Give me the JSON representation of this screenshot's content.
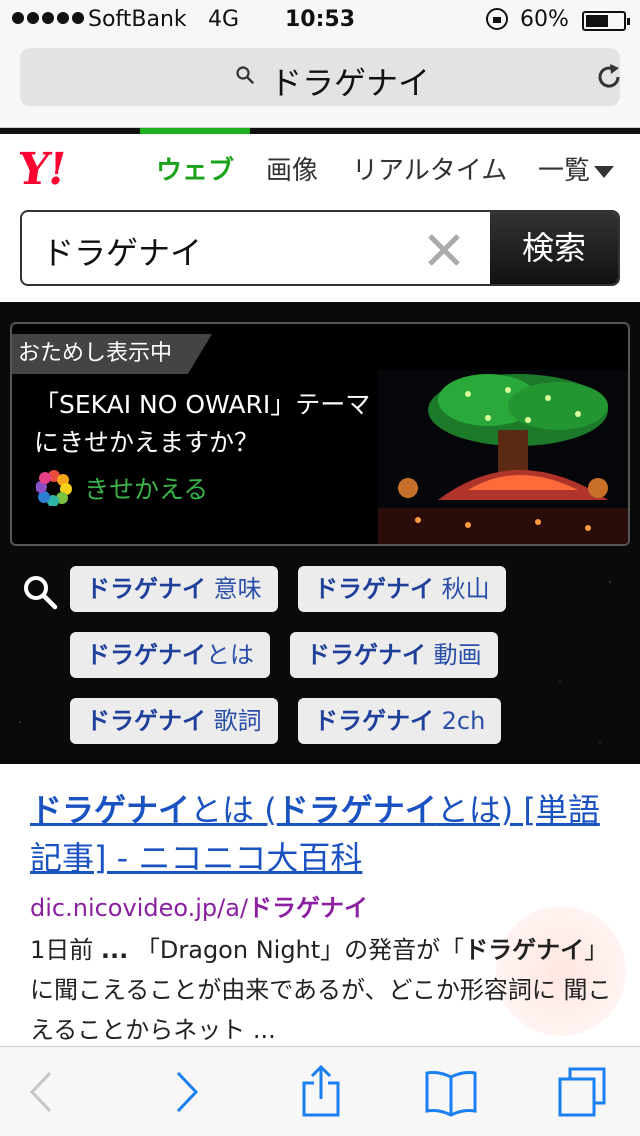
{
  "status": {
    "carrier": "SoftBank",
    "network": "4G",
    "time": "10:53",
    "battery": "60%",
    "battery_level": 0.6
  },
  "address_bar": {
    "url": "ドラゲナイ"
  },
  "header": {
    "logo": "Y!",
    "tabs": [
      "ウェブ",
      "画像",
      "リアルタイム",
      "一覧"
    ],
    "active_tab": "ウェブ",
    "colors": {
      "logo": "#ff0033",
      "active": "#1aa31a"
    }
  },
  "search": {
    "value": "ドラゲナイ",
    "button": "検索"
  },
  "promo": {
    "badge": "おためし表示中",
    "line1": "「SEKAI NO OWARI」テーマ",
    "line2": "にきせかえますか？",
    "action": "きせかえる"
  },
  "suggestions": [
    {
      "keyword": "ドラゲナイ",
      "extra": "意味"
    },
    {
      "keyword": "ドラゲナイ",
      "extra": "秋山"
    },
    {
      "keyword": "ドラゲナイ",
      "extra": "とは"
    },
    {
      "keyword": "ドラゲナイ",
      "extra": "動画"
    },
    {
      "keyword": "ドラゲナイ",
      "extra": "歌詞"
    },
    {
      "keyword": "ドラゲナイ",
      "extra": "2ch"
    }
  ],
  "result": {
    "title_bold1": "ドラゲナイ",
    "title_1": "とは (",
    "title_bold2": "ドラゲナイ",
    "title_2": "とは) [単語記事] - ニコニコ大百科",
    "url_prefix": "dic.nicovideo.jp/a/",
    "url_bold": "ドラゲナイ",
    "snip_1": "1日前 ",
    "snip_ellipsis": "...",
    "snip_2": " 「Dragon Night」の発音が「",
    "snip_bold": "ドラゲナイ",
    "snip_3": "」に聞こえることが由来であるが、どこか形容詞に 聞こえることからネット ..."
  },
  "toolbar": {
    "icons": [
      "back-icon",
      "forward-icon",
      "share-icon",
      "bookmarks-icon",
      "tabs-icon"
    ]
  }
}
